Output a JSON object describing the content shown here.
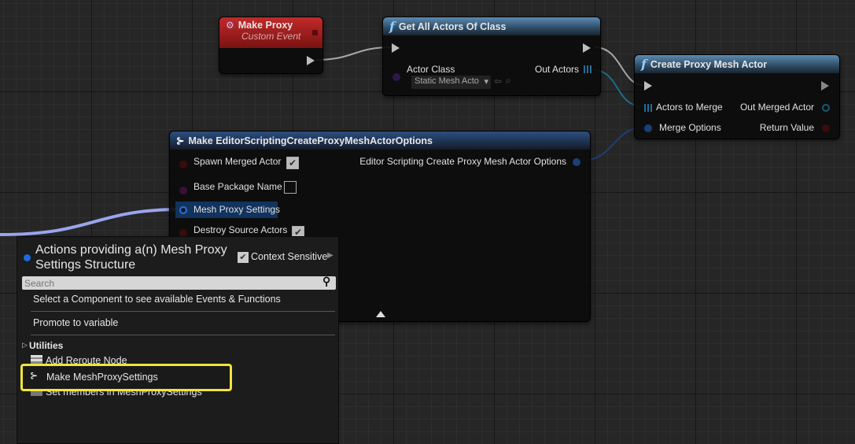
{
  "nodes": {
    "make_proxy": {
      "title": "Make Proxy",
      "subtitle": "Custom Event",
      "header_color": "#a01d1d"
    },
    "get_all_actors": {
      "title": "Get All Actors Of Class",
      "actor_class_label": "Actor Class",
      "actor_class_value": "Static Mesh Acto",
      "out_actors_label": "Out Actors"
    },
    "create_proxy": {
      "title": "Create Proxy Mesh Actor",
      "actors_to_merge": "Actors to Merge",
      "merge_options": "Merge Options",
      "out_merged_actor": "Out Merged Actor",
      "return_value": "Return Value"
    },
    "make_options": {
      "title": "Make EditorScriptingCreateProxyMeshActorOptions",
      "pins": [
        "Spawn Merged Actor",
        "Base Package Name",
        "Mesh Proxy Settings",
        "Destroy Source Actors"
      ],
      "output": "Editor Scripting Create Proxy Mesh Actor Options",
      "spawn_checked": true,
      "base_package_checked": false,
      "destroy_checked": true
    }
  },
  "menu": {
    "title": "Actions providing a(n) Mesh Proxy Settings Structure",
    "context_sensitive_label": "Context Sensitive",
    "context_sensitive_checked": true,
    "search_placeholder": "Search",
    "items": [
      "Select a Component to see available Events & Functions",
      "Promote to variable"
    ],
    "category": "Utilities",
    "category_items": [
      "Add Reroute Node",
      "Make MeshProxySettings",
      "Set members in MeshProxySettings"
    ],
    "highlight_color": "#f2e33a"
  }
}
